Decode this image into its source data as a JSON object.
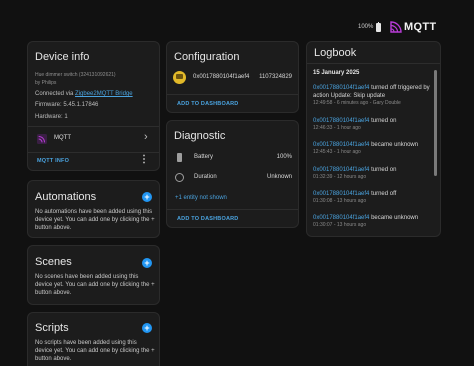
{
  "topbar": {
    "battery": "100%",
    "brand": "MQTT",
    "accent": "#b93cd7"
  },
  "device_info": {
    "title": "Device info",
    "model": "Hue dimmer switch (324131092621)",
    "manufacturer": "by Philips",
    "connected_via_prefix": "Connected via",
    "connected_via_link": "Zigbee2MQTT Bridge",
    "firmware": "Firmware: 5.45.1.17846",
    "hardware": "Hardware: 1",
    "integration": "MQTT",
    "action": "MQTT INFO",
    "more_icon": "⋮",
    "chevron_icon": "›"
  },
  "automations": {
    "title": "Automations",
    "empty": "No automations have been added using this device yet. You can add one by clicking the + button above."
  },
  "scenes": {
    "title": "Scenes",
    "empty": "No scenes have been added using this device yet. You can add one by clicking the + button above."
  },
  "scripts": {
    "title": "Scripts",
    "empty": "No scripts have been added using this device yet. You can add one by clicking the + button above."
  },
  "configuration": {
    "title": "Configuration",
    "entity": "0x0017880104f1aef4",
    "value": "1107324829",
    "action": "ADD TO DASHBOARD"
  },
  "diagnostic": {
    "title": "Diagnostic",
    "rows": [
      {
        "label": "Battery",
        "value": "100%"
      },
      {
        "label": "Duration",
        "value": "Unknown"
      }
    ],
    "hidden_link": "+1 entity not shown",
    "action": "ADD TO DASHBOARD"
  },
  "logbook": {
    "title": "Logbook",
    "date": "15 January 2025",
    "entries": [
      {
        "entity": "0x0017880104f1aef4",
        "message": "turned off triggered by action Update: Skip update",
        "meta": "12:49:58 - 6 minutes ago - Gary Double"
      },
      {
        "entity": "0x0017880104f1aef4",
        "message": "turned on",
        "meta": "12:46:33 - 1 hour ago"
      },
      {
        "entity": "0x0017880104f1aef4",
        "message": "became unknown",
        "meta": "12:45:43 - 1 hour ago"
      },
      {
        "entity": "0x0017880104f1aef4",
        "message": "turned on",
        "meta": "01:32:39 - 12 hours ago"
      },
      {
        "entity": "0x0017880104f1aef4",
        "message": "turned off",
        "meta": "01:30:08 - 13 hours ago"
      },
      {
        "entity": "0x0017880104f1aef4",
        "message": "became unknown",
        "meta": "01:30:07 - 13 hours ago"
      }
    ]
  }
}
